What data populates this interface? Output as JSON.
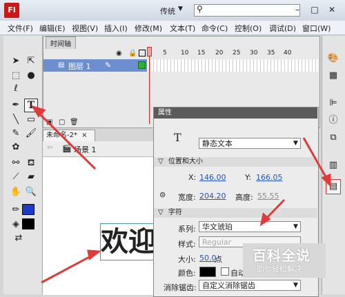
{
  "app": {
    "logo_text": "Fl",
    "layout_mode": "传统",
    "search_placeholder": ""
  },
  "menu": [
    "文件(F)",
    "编辑(E)",
    "视图(V)",
    "插入(I)",
    "修改(M)",
    "文本(T)",
    "命令(C)",
    "控制(O)",
    "调试(D)",
    "窗口(W)"
  ],
  "timeline": {
    "tab": "时间轴",
    "layer_name": "图层 1",
    "frame_numbers": [
      "1",
      "5",
      "10",
      "15",
      "20",
      "25",
      "30",
      "35",
      "40"
    ]
  },
  "document": {
    "tab": "未命名-2*",
    "close": "×",
    "scene": "场景 1",
    "stage_text": "欢迎"
  },
  "properties": {
    "title": "属性",
    "text_type": "静态文本",
    "sec_position": "位置和大小",
    "x_label": "X:",
    "x_value": "146.00",
    "y_label": "Y:",
    "y_value": "166.05",
    "w_label": "宽度:",
    "w_value": "204.20",
    "h_label": "高度:",
    "h_value": "55.55",
    "sec_char": "字符",
    "family_label": "系列:",
    "family_value": "华文琥珀",
    "style_label": "样式:",
    "style_value": "Regular",
    "size_label": "大小:",
    "size_value": "50.0",
    "size_unit": "点",
    "color_label": "颜色:",
    "autokern_label": "自动",
    "aa_label": "消除锯齿:",
    "aa_value": "自定义消除锯齿"
  },
  "watermark": {
    "title": "百科全说",
    "subtitle": "助你轻松解决"
  },
  "colors": {
    "accent": "#c81818",
    "stroke_swatch": "#1a3cc8",
    "fill_swatch": "#000000",
    "layer_highlight": "#6d8fd0",
    "arrow": "#e03a3a"
  }
}
